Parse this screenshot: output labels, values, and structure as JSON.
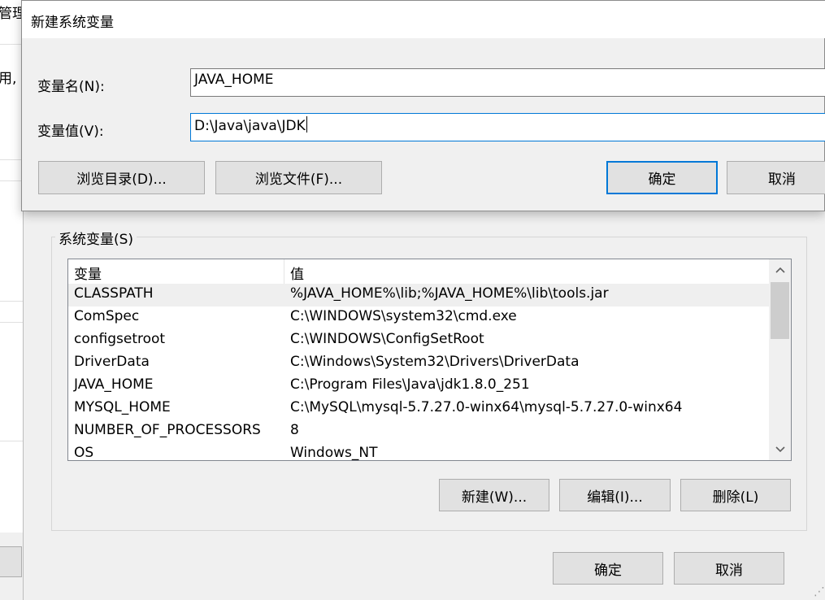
{
  "background": {
    "left_fragments": [
      "管理",
      "用,"
    ]
  },
  "dialog": {
    "title": "新建系统变量",
    "name_label": "变量名(N):",
    "name_value": "JAVA_HOME",
    "value_label": "变量值(V):",
    "value_value": "D:\\Java\\java\\JDK",
    "browse_dir_label": "浏览目录(D)...",
    "browse_file_label": "浏览文件(F)...",
    "ok_label": "确定",
    "cancel_label": "取消"
  },
  "system_variables": {
    "group_label": "系统变量(S)",
    "columns": [
      "变量",
      "值"
    ],
    "rows": [
      {
        "name": "CLASSPATH",
        "value": "%JAVA_HOME%\\lib;%JAVA_HOME%\\lib\\tools.jar",
        "selected": true
      },
      {
        "name": "ComSpec",
        "value": "C:\\WINDOWS\\system32\\cmd.exe"
      },
      {
        "name": "configsetroot",
        "value": "C:\\WINDOWS\\ConfigSetRoot"
      },
      {
        "name": "DriverData",
        "value": "C:\\Windows\\System32\\Drivers\\DriverData"
      },
      {
        "name": "JAVA_HOME",
        "value": "C:\\Program Files\\Java\\jdk1.8.0_251"
      },
      {
        "name": "MYSQL_HOME",
        "value": "C:\\MySQL\\mysql-5.7.27.0-winx64\\mysql-5.7.27.0-winx64"
      },
      {
        "name": "NUMBER_OF_PROCESSORS",
        "value": "8"
      },
      {
        "name": "OS",
        "value": "Windows_NT"
      }
    ],
    "new_label": "新建(W)...",
    "edit_label": "编辑(I)...",
    "delete_label": "删除(L)"
  },
  "window": {
    "ok_label": "确定",
    "cancel_label": "取消"
  },
  "colors": {
    "accent": "#0078d7",
    "button_face": "#e1e1e1",
    "window_bg": "#f0f0f0"
  }
}
